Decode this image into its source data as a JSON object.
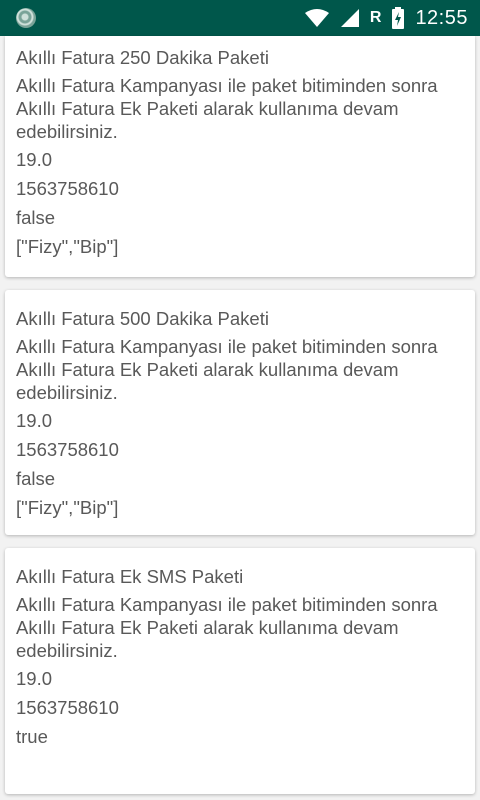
{
  "status_bar": {
    "time": "12:55",
    "network_indicator": "R",
    "icons": [
      "app-notification-icon",
      "wifi-icon",
      "cellular-signal-icon",
      "battery-charging-icon"
    ]
  },
  "packages": [
    {
      "name": "Akıllı Fatura 250 Dakika Paketi",
      "description": "Akıllı Fatura Kampanyası ile paket bitiminden sonra Akıllı Fatura Ek Paketi alarak kullanıma devam edebilirsiniz.",
      "price": "19.0",
      "timestamp": "1563758610",
      "flag": "false",
      "apps": "[\"Fizy\",\"Bip\"]"
    },
    {
      "name": "Akıllı Fatura 500 Dakika Paketi",
      "description": "Akıllı Fatura Kampanyası ile paket bitiminden sonra Akıllı Fatura Ek Paketi alarak kullanıma devam edebilirsiniz.",
      "price": "19.0",
      "timestamp": "1563758610",
      "flag": "false",
      "apps": "[\"Fizy\",\"Bip\"]"
    },
    {
      "name": "Akıllı Fatura Ek SMS Paketi",
      "description": "Akıllı Fatura Kampanyası ile paket bitiminden sonra Akıllı Fatura Ek Paketi alarak kullanıma devam edebilirsiniz.",
      "price": "19.0",
      "timestamp": "1563758610",
      "flag": "true"
    }
  ]
}
